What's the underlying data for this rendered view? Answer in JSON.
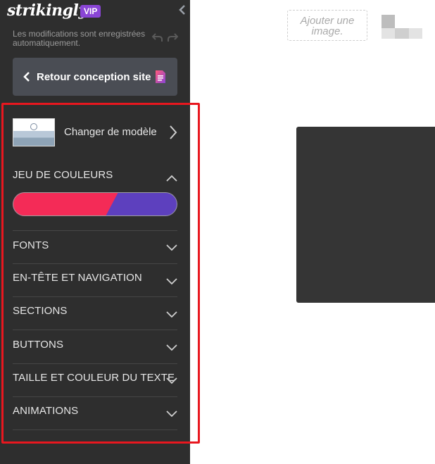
{
  "sidebar": {
    "brand": "strikingly",
    "vip_badge": "VIP",
    "autosave_text": "Les modifications sont enregistrées automatiquement.",
    "back_button": "Retour conception site",
    "template": {
      "label": "Changer de modèle"
    },
    "color_scheme": {
      "title": "JEU DE COULEURS",
      "colors": [
        "#f42b57",
        "#5d40be"
      ]
    },
    "sections": [
      {
        "label": "FONTS"
      },
      {
        "label": "EN-TÊTE ET NAVIGATION"
      },
      {
        "label": "SECTIONS"
      },
      {
        "label": "BUTTONS"
      },
      {
        "label": "TAILLE ET COULEUR DU TEXTE"
      },
      {
        "label": "ANIMATIONS"
      }
    ]
  },
  "canvas": {
    "add_image": "Ajouter une image."
  },
  "colors": {
    "sidebar_bg": "#2e2e2e",
    "vip": "#8a45d6",
    "highlight": "#e8171f",
    "back_button_bg": "#4a4d54"
  }
}
